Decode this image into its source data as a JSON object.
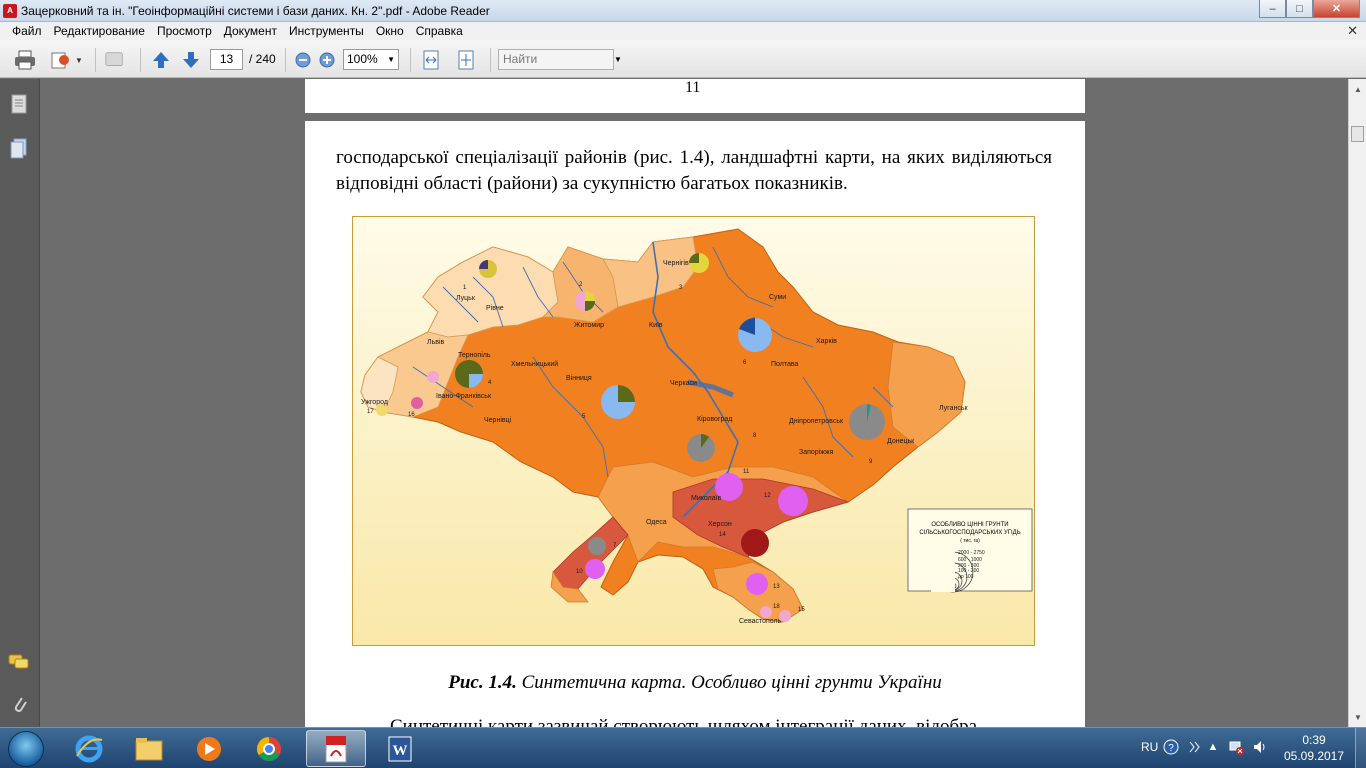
{
  "window": {
    "title": "Зацерковний та ін. \"Геоінформаційні системи і бази даних. Кн. 2\".pdf - Adobe Reader",
    "app_icon": "adobe-reader-icon",
    "buttons": {
      "minimize": "–",
      "maximize": "□",
      "close": "✕"
    }
  },
  "menu": {
    "items": [
      "Файл",
      "Редактирование",
      "Просмотр",
      "Документ",
      "Инструменты",
      "Окно",
      "Справка"
    ],
    "close_glyph": "✕"
  },
  "toolbar": {
    "current_page": "13",
    "page_total": "/ 240",
    "zoom": "100%",
    "find_placeholder": "Найти"
  },
  "document": {
    "prev_page_number": "11",
    "paragraph": "господарської спеціалізації районів (рис. 1.4), ландшафтні карти, на яких виділяються відповідні області (райони) за сукупністю багатьох показників.",
    "caption_label": "Рис. 1.4.",
    "caption_text": " Синтетична карта. Особливо цінні грунти України",
    "next_paragraph": "Синтетичні карти зазвичай створюють шляхом інтеграції даних, відобра"
  },
  "map": {
    "legend": {
      "title_lines": [
        "ОСОБЛИВО ЦІННІ ГРУНТИ",
        "СІЛЬСЬКОГОСПОДАРСЬКИХ УГІДЬ",
        "( тис. га)"
      ],
      "classes": [
        "2000 - 2750",
        "600 - 1000",
        "200 - 300",
        "100 - 200",
        "до 100"
      ]
    },
    "cities": [
      "Луцьк",
      "Рівне",
      "Житомир",
      "Київ",
      "Чернігів",
      "Суми",
      "Харків",
      "Полтава",
      "Черкаси",
      "Львів",
      "Тернопіль",
      "Хмельницький",
      "Вінниця",
      "Ужгород",
      "Івано-Франківськ",
      "Чернівці",
      "Кіровоград",
      "Дніпропетровськ",
      "Луганськ",
      "Донецьк",
      "Запоріжжя",
      "Миколаїв",
      "Херсон",
      "Одеса",
      "Севастополь"
    ],
    "region_numbers": [
      "1",
      "2",
      "3",
      "4",
      "5",
      "6",
      "7",
      "8",
      "9",
      "10",
      "11",
      "12",
      "13",
      "14",
      "15",
      "16",
      "17",
      "18"
    ],
    "colors": {
      "deep_orange": "#f07f1c",
      "mid_orange": "#f5a04d",
      "light_orange": "#f9c089",
      "pale": "#fce3c2",
      "dark_red": "#d8583e",
      "river": "#3f6fb5"
    }
  },
  "taskbar": {
    "apps": [
      "internet-explorer-icon",
      "explorer-icon",
      "media-player-icon",
      "chrome-icon",
      "adobe-reader-icon",
      "word-icon"
    ],
    "lang": "RU",
    "time": "0:39",
    "date": "05.09.2017"
  }
}
